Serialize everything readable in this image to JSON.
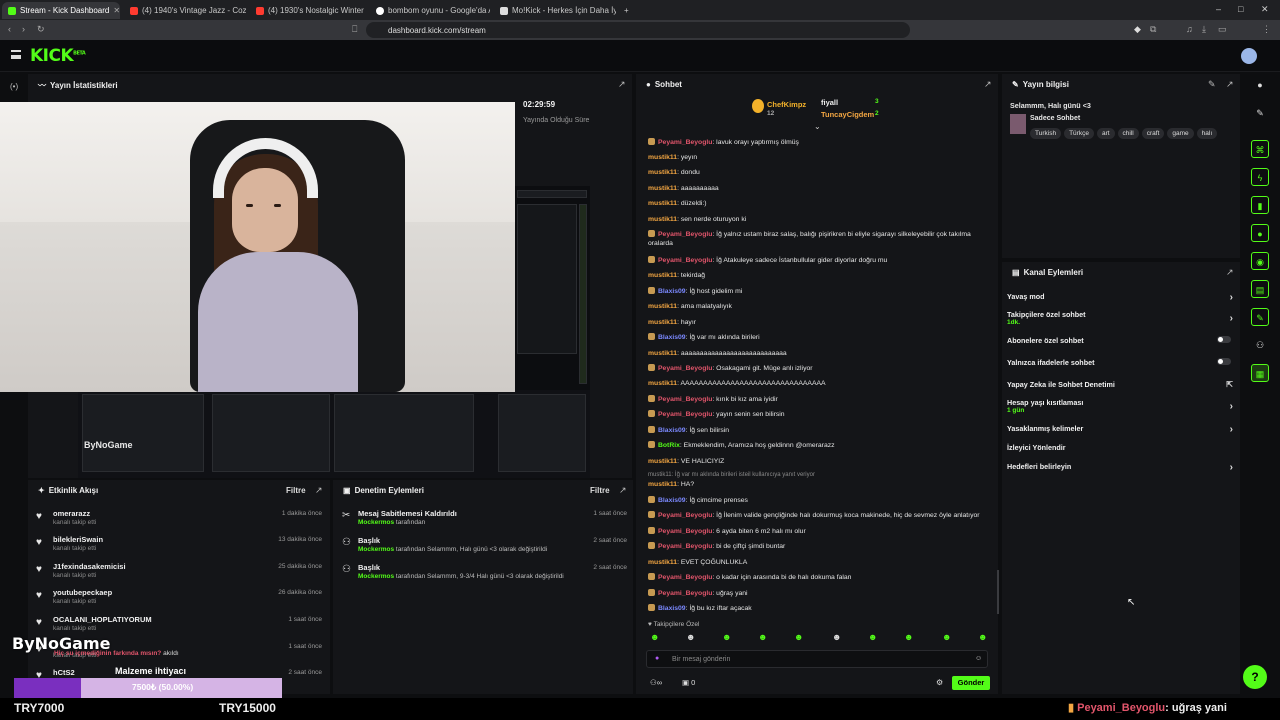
{
  "browser": {
    "tabs": [
      {
        "title": "Stream - Kick Dashboard",
        "color": "#53fc18"
      },
      {
        "title": "(4) 1940's Vintage Jazz - Cozy Sw",
        "color": "#ff3b30"
      },
      {
        "title": "(4) 1930's Nostalgic Winter Jazz Play",
        "color": "#ff3b30"
      },
      {
        "title": "bombom oyunu - Google'da Ara",
        "color": "#ffffff"
      },
      {
        "title": "Mo!Kick - Herkes İçin Daha İyi Bir Kick",
        "color": "#ffffff"
      }
    ],
    "url": "dashboard.kick.com/stream"
  },
  "header": {
    "logo": "KICK",
    "logo_sup": "BETA"
  },
  "stats": {
    "title": "Yayın İstatistikleri",
    "time": "02:29:59",
    "time_label": "Yayında Olduğu Süre"
  },
  "activity": {
    "title": "Etkinlik Akışı",
    "filter": "Filtre",
    "items": [
      {
        "name": "omerarazz",
        "sub": "kanalı takip etti",
        "time": "1 dakika önce"
      },
      {
        "name": "bilekleriSwain",
        "sub": "kanalı takip etti",
        "time": "13 dakika önce"
      },
      {
        "name": "J1fexindasakemicisi",
        "sub": "kanalı takip etti",
        "time": "25 dakika önce"
      },
      {
        "name": "youtubepeckaep",
        "sub": "kanalı takip etti",
        "time": "26 dakika önce"
      },
      {
        "name": "OCALANI_HOPLATIYORUM",
        "sub": "kanalı takip etti",
        "time": "1 saat önce"
      },
      {
        "name": "",
        "sub": "kanalı takip etti",
        "time": "1 saat önce"
      },
      {
        "name": "hCtS2",
        "sub": "",
        "time": "2 saat önce"
      }
    ]
  },
  "moderation": {
    "title": "Denetim Eylemleri",
    "filter": "Filtre",
    "items": [
      {
        "title": "Mesaj Sabitlemesi Kaldırıldı",
        "user": "Mockermos",
        "rest": " tarafından",
        "time": "1 saat önce"
      },
      {
        "title": "Başlık",
        "user": "Mockermos",
        "rest": " tarafından Selammm, Halı günü <3 olarak değiştirildi",
        "time": "2 saat önce"
      },
      {
        "title": "Başlık",
        "user": "Mockermos",
        "rest": " tarafından Selammm, 9-3/4 Halı günü <3 olarak değiştirildi",
        "time": "2 saat önce"
      }
    ]
  },
  "chat": {
    "title": "Sohbet",
    "leaders": [
      {
        "name": "ChefKimpz",
        "count": "12"
      },
      {
        "name": "fiyall",
        "count": "3"
      },
      {
        "name": "TuncayCigdem",
        "count": "2"
      }
    ],
    "messages": [
      {
        "user": "Peyami_Beyoglu",
        "cls": "c-p",
        "text": ": lavuk orayı yaptırmış ölmüş",
        "badge": true
      },
      {
        "user": "mustik11",
        "cls": "c-m",
        "text": ": yeyın",
        "badge": false
      },
      {
        "user": "mustik11",
        "cls": "c-m",
        "text": ": dondu",
        "badge": false
      },
      {
        "user": "mustik11",
        "cls": "c-m",
        "text": ": aaaaaaaaaa",
        "badge": false
      },
      {
        "user": "mustik11",
        "cls": "c-m",
        "text": ": düzeldi:)",
        "badge": false
      },
      {
        "user": "mustik11",
        "cls": "c-m",
        "text": ": sen nerde oturuyon ki",
        "badge": false
      },
      {
        "user": "Peyami_Beyoglu",
        "cls": "c-p",
        "text": ": İğ yalnız ustam biraz salaş, balığı pişirikren bi eliyle sigarayı silkeleyebilir çok takılma oralarda",
        "badge": true
      },
      {
        "user": "Peyami_Beyoglu",
        "cls": "c-p",
        "text": ": İğ Atakuleye sadece İstanbullular gider diyorlar doğru mu",
        "badge": true
      },
      {
        "user": "mustik11",
        "cls": "c-m",
        "text": ": tekirdağ",
        "badge": false
      },
      {
        "user": "Blaxis09",
        "cls": "c-b",
        "text": ": İğ host gidelim mi",
        "badge": true
      },
      {
        "user": "mustik11",
        "cls": "c-m",
        "text": ": ama malatyalıyık",
        "badge": false
      },
      {
        "user": "mustik11",
        "cls": "c-m",
        "text": ": hayır",
        "badge": false
      },
      {
        "user": "Blaxis09",
        "cls": "c-b",
        "text": ": İğ var mı aklında birileri",
        "badge": true
      },
      {
        "user": "mustik11",
        "cls": "c-m",
        "text": ": aaaaaaaaaaaaaaaaaaaaaaaaaaaa",
        "badge": false
      },
      {
        "user": "Peyami_Beyoglu",
        "cls": "c-p",
        "text": ": Osakagami git. Müge anlı izliyor",
        "badge": true
      },
      {
        "user": "mustik11",
        "cls": "c-m",
        "text": ": AAAAAAAAAAAAAAAAAAAAAAAAAAAAAAAA",
        "badge": false
      },
      {
        "user": "Peyami_Beyoglu",
        "cls": "c-p",
        "text": ": kırık bi kız ama iyidir",
        "badge": true
      },
      {
        "user": "Peyami_Beyoglu",
        "cls": "c-p",
        "text": ": yayın senin sen bilirsin",
        "badge": true
      },
      {
        "user": "Blaxis09",
        "cls": "c-b",
        "text": ": İğ sen bilirsin",
        "badge": true
      },
      {
        "user": "BotRix",
        "cls": "c-g",
        "text": ": Ekmeklendim, Aramıza hoş geldinnn @omerarazz",
        "badge": true
      },
      {
        "user": "mustik11",
        "cls": "c-m",
        "text": ": VE HALICIYIZ",
        "badge": false
      },
      {
        "user": "",
        "cls": "",
        "text": "mustik11: İğ var mı aklında birileri isteil kullanıcıya yanıt veriyor",
        "badge": false
      },
      {
        "user": "mustik11",
        "cls": "c-m",
        "text": ": HA?",
        "badge": false
      },
      {
        "user": "Blaxis09",
        "cls": "c-b",
        "text": ": İğ cimcime prenses",
        "badge": true
      },
      {
        "user": "Peyami_Beyoglu",
        "cls": "c-p",
        "text": ": İğ İlenim valide gençliğinde halı dokurmuş koca makinede, hiç de sevmez öyle anlatıyor",
        "badge": true
      },
      {
        "user": "Peyami_Beyoglu",
        "cls": "c-p",
        "text": ": 6 ayda biten 6 m2 halı mı olur",
        "badge": true
      },
      {
        "user": "Peyami_Beyoglu",
        "cls": "c-p",
        "text": ": bi de çiftçi şimdi buntar",
        "badge": true
      },
      {
        "user": "mustik11",
        "cls": "c-m",
        "text": ": EVET ÇOĞUNLUKLA",
        "badge": false
      },
      {
        "user": "Peyami_Beyoglu",
        "cls": "c-p",
        "text": ": o kadar için arasında bi de halı dokuma falan",
        "badge": true
      },
      {
        "user": "Peyami_Beyoglu",
        "cls": "c-p",
        "text": ": uğraş yani",
        "badge": true
      },
      {
        "user": "Blaxis09",
        "cls": "c-b",
        "text": ": İğ bu kız iftar açacak",
        "badge": true
      }
    ],
    "followers_only": "Takipçilere Özel",
    "input_placeholder": "Bir mesaj gönderin",
    "count_a": "0",
    "send": "Gönder"
  },
  "info": {
    "title": "Yayın bilgisi",
    "stream_title": "Selammm, Halı günü <3",
    "mode": "Sadece Sohbet",
    "tags": [
      "Turkish",
      "Türkçe",
      "art",
      "chill",
      "craft",
      "game",
      "halı"
    ]
  },
  "actions": {
    "title": "Kanal Eylemleri",
    "items": [
      {
        "label": "Yavaş mod",
        "sub": "",
        "ctl": "chev"
      },
      {
        "label": "Takipçilere özel sohbet",
        "sub": "1dk.",
        "ctl": "chev"
      },
      {
        "label": "Abonelere özel sohbet",
        "sub": "",
        "ctl": "toggle"
      },
      {
        "label": "Yalnızca ifadelerle sohbet",
        "sub": "",
        "ctl": "toggle"
      },
      {
        "label": "Yapay Zeka ile Sohbet Denetimi",
        "sub": "",
        "ctl": "ext"
      },
      {
        "label": "Hesap yaşı kısıtlaması",
        "sub": "1 gün",
        "ctl": "chev"
      },
      {
        "label": "Yasaklanmış kelimeler",
        "sub": "",
        "ctl": "chev"
      },
      {
        "label": "İzleyici Yönlendir",
        "sub": "",
        "ctl": ""
      },
      {
        "label": "Hedefleri belirleyin",
        "sub": "",
        "ctl": "chev"
      }
    ]
  },
  "overlay": {
    "brand": "ByNoGame",
    "sub_a": "Hiç su içmediğinin farkında mısın?",
    "sub_b": " akıldı",
    "material": "Malzeme ihtiyacı",
    "progress_text": "7500₺ (50.00%)",
    "progress": 0.5,
    "left_target": "TRY7000",
    "right_target": "TRY15000",
    "ticker_user": "Peyami_Beyoglu",
    "ticker_text": ": uğraş yani"
  }
}
